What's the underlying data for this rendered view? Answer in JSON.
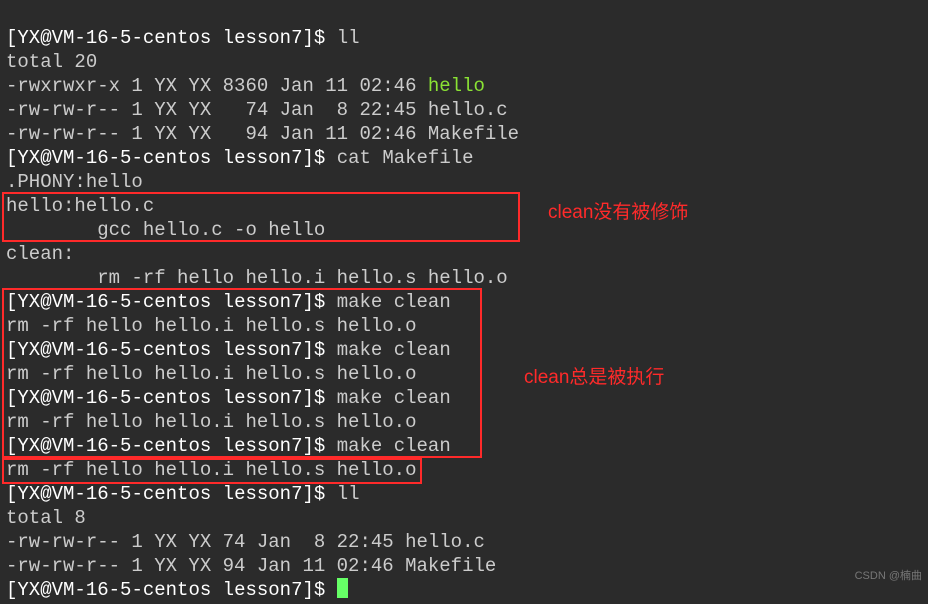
{
  "prompt": {
    "user": "YX",
    "host": "VM-16-5-centos",
    "dir": "lesson7",
    "symbol": "$"
  },
  "commands": {
    "ll1": "ll",
    "cat": "cat Makefile",
    "makeclean": "make clean",
    "ll2": "ll"
  },
  "outputs": {
    "total1": "total 20",
    "ls1_perm_exec": "-rwxrwxr-x 1 YX YX 8360 Jan 11 02:46 ",
    "ls1_hello": "hello",
    "ls1_row2": "-rw-rw-r-- 1 YX YX   74 Jan  8 22:45 hello.c",
    "ls1_row3": "-rw-rw-r-- 1 YX YX   94 Jan 11 02:46 Makefile",
    "makefile_l1": ".PHONY:hello",
    "makefile_l2": "hello:hello.c",
    "makefile_l3": "        gcc hello.c -o hello",
    "makefile_l4": "clean:",
    "makefile_l5": "        rm -rf hello hello.i hello.s hello.o",
    "rm_output": "rm -rf hello hello.i hello.s hello.o",
    "total2": "total 8",
    "ls2_row1": "-rw-rw-r-- 1 YX YX 74 Jan  8 22:45 hello.c",
    "ls2_row2": "-rw-rw-r-- 1 YX YX 94 Jan 11 02:46 Makefile"
  },
  "annotations": {
    "a1": "clean没有被修饰",
    "a2": "clean总是被执行"
  },
  "watermark": "CSDN @楠曲"
}
